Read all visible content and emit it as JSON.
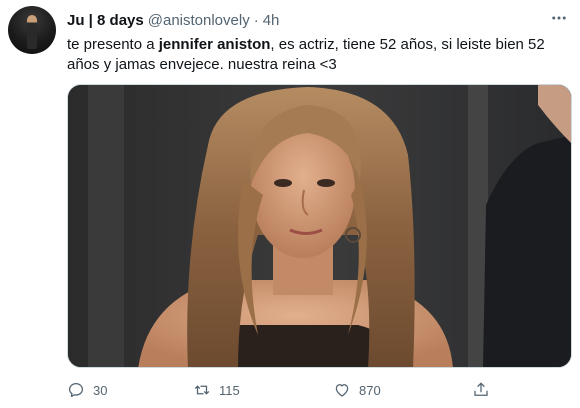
{
  "tweet": {
    "name": "Ju | 8 days",
    "handle": "@anistonlovely",
    "separator": "·",
    "time": "4h",
    "more_icon": "more-horizontal-icon",
    "text_before": "te presento a ",
    "text_bold": "jennifer aniston",
    "text_after": ", es actriz, tiene 52 años, si leiste bien 52 años y jamas envejece. nuestra reina   <3",
    "media": {
      "description_icon": "photo"
    },
    "actions": {
      "reply_count": "30",
      "retweet_count": "115",
      "like_count": "870"
    }
  },
  "colors": {
    "muted": "#536471",
    "text": "#0f1419",
    "border": "#cfd9de"
  }
}
